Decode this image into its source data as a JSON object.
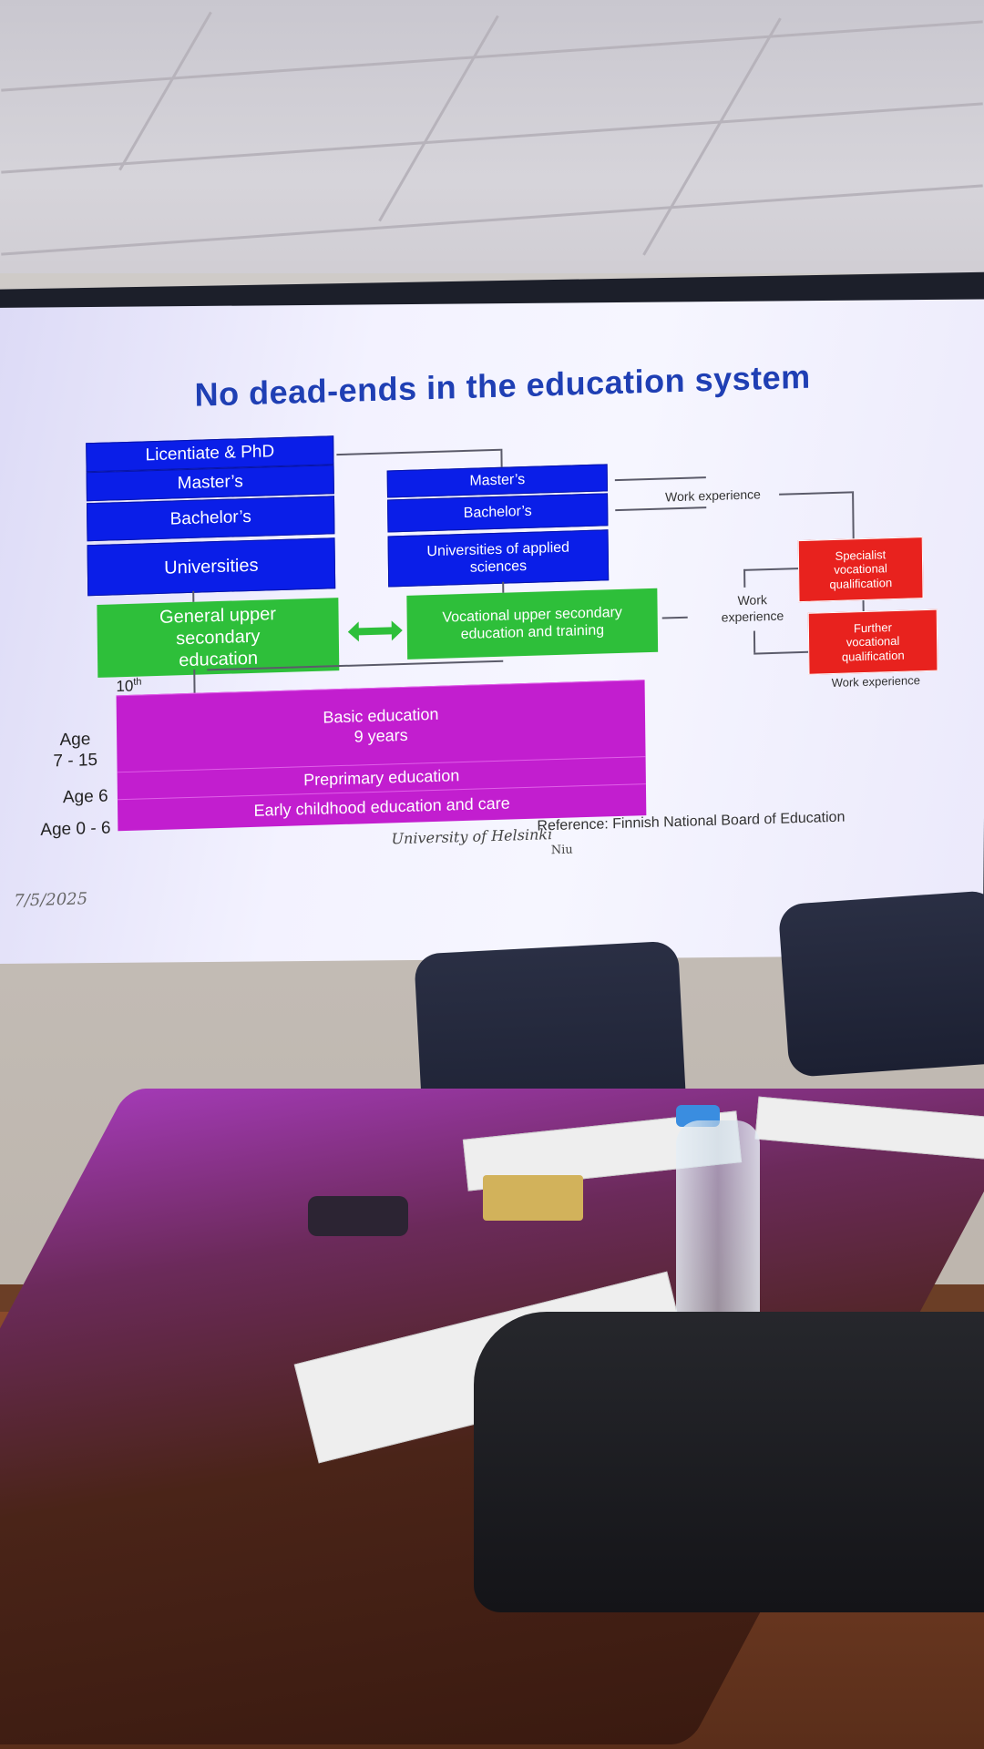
{
  "slide": {
    "title": "No dead-ends in the education system",
    "boxes": {
      "licentiate_phd": "Licentiate & PhD",
      "masters_left": "Master’s",
      "bachelors_left": "Bachelor’s",
      "universities": "Universities",
      "masters_right": "Master’s",
      "bachelors_right": "Bachelor’s",
      "universities_applied_1": "Universities of applied",
      "universities_applied_2": "sciences",
      "general_upper_1": "General upper",
      "general_upper_2": "secondary",
      "general_upper_3": "education",
      "vocational_upper_1": "Vocational upper secondary",
      "vocational_upper_2": "education and training",
      "specialist_1": "Specialist",
      "specialist_2": "vocational",
      "specialist_3": "qualification",
      "further_1": "Further",
      "further_2": "vocational",
      "further_3": "qualification",
      "basic_1": "Basic education",
      "basic_2": "9 years",
      "preprimary": "Preprimary education",
      "early_childhood": "Early childhood education and care"
    },
    "labels": {
      "tenth": "10",
      "tenth_sup": "th",
      "work_experience_top": "Work experience",
      "work_experience_mid_1": "Work",
      "work_experience_mid_2": "experience",
      "work_experience_bottom": "Work experience",
      "age_7_15_a": "Age",
      "age_7_15_b": "7 - 15",
      "age_6": "Age 6",
      "age_0_6": "Age 0 - 6"
    },
    "footer": {
      "university": "University of Helsinki",
      "reference": "Reference: Finnish National Board of Education",
      "author": "Niu",
      "date": "7/5/2025"
    },
    "colors": {
      "title": "#1f3fb4",
      "blue_box": "#0a1ee8",
      "green_box": "#2ebf3a",
      "red_box": "#e8221e",
      "magenta_box": "#c21ecf"
    }
  }
}
